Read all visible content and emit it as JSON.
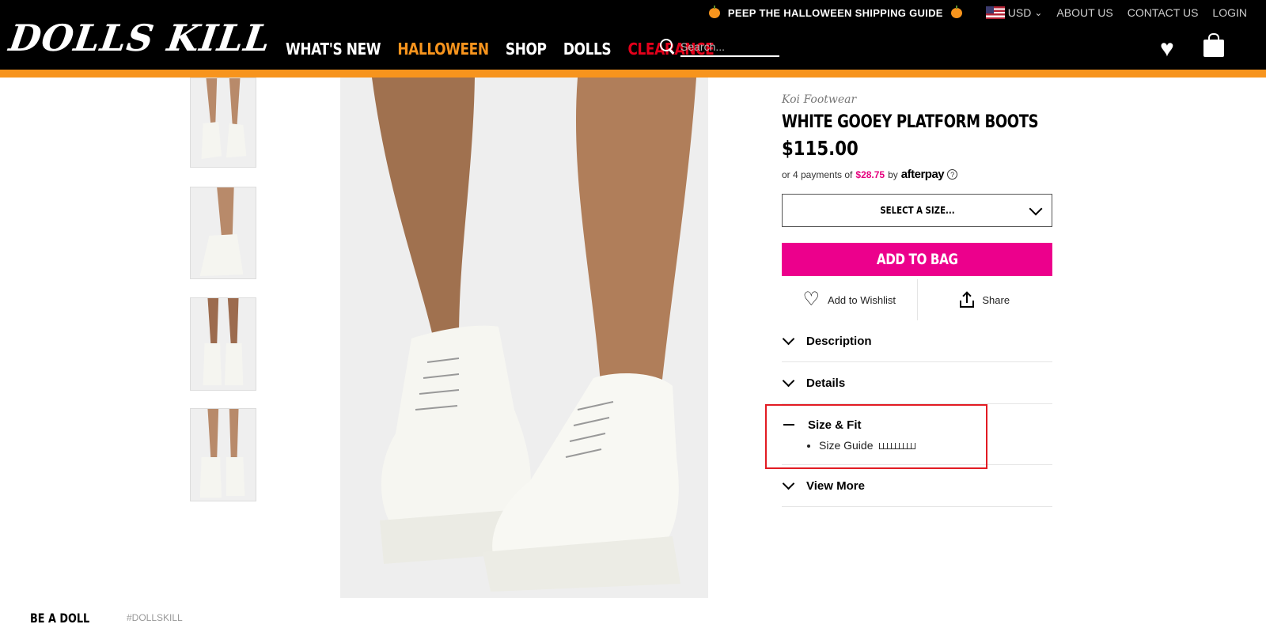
{
  "header": {
    "promo": "PEEP THE HALLOWEEN SHIPPING GUIDE",
    "currency": "USD",
    "links": [
      "ABOUT US",
      "CONTACT US",
      "LOGIN"
    ],
    "logo": "DOLLS KILL",
    "nav": [
      "WHAT'S NEW",
      "HALLOWEEN",
      "SHOP",
      "DOLLS",
      "CLEARANCE"
    ],
    "search_placeholder": "Search...",
    "colors": {
      "accent_orange": "#f7941d",
      "clearance_red": "#e4001b"
    }
  },
  "product": {
    "brand": "Koi Footwear",
    "title": "WHITE GOOEY PLATFORM BOOTS",
    "price": "$115.00",
    "afterpay": {
      "prefix": "or 4 payments of",
      "amount": "$28.75",
      "by": "by",
      "logo": "afterpay",
      "help": "?"
    },
    "size_select": "SELECT A SIZE...",
    "add_to_bag": "ADD TO BAG",
    "wishlist": "Add to Wishlist",
    "share": "Share",
    "accordion": [
      {
        "title": "Description",
        "expanded": false
      },
      {
        "title": "Details",
        "expanded": false
      },
      {
        "title": "Size & Fit",
        "expanded": true,
        "items": [
          "Size Guide"
        ]
      },
      {
        "title": "View More",
        "expanded": false
      }
    ],
    "colors": {
      "add_to_bag": "#ec008c",
      "afterpay_amount": "#e6007e",
      "highlight": "#e21b23"
    }
  },
  "footer": {
    "heading": "BE A DOLL",
    "hashtag": "#DOLLSKILL"
  }
}
